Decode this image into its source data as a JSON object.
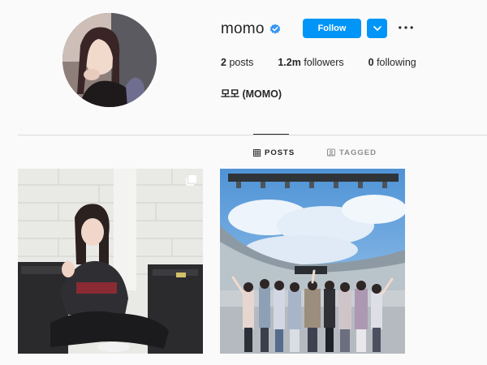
{
  "profile": {
    "username": "momo",
    "verified": true,
    "full_name": "모모 (MOMO)"
  },
  "actions": {
    "follow_label": "Follow",
    "dropdown_icon": "chevron-down-icon",
    "more_icon": "more-horizontal-icon"
  },
  "stats": {
    "posts_count": "2",
    "posts_label": "posts",
    "followers_count": "1.2m",
    "followers_label": "followers",
    "following_count": "0",
    "following_label": "following"
  },
  "tabs": [
    {
      "label": "POSTS",
      "icon": "grid-icon",
      "active": true
    },
    {
      "label": "TAGGED",
      "icon": "tagged-icon",
      "active": false
    }
  ],
  "colors": {
    "accent": "#0095f6",
    "text": "#262626",
    "muted": "#8e8e8e",
    "background": "#fafafa",
    "divider": "#dbdbdb"
  },
  "posts": [
    {
      "type": "multi-photo",
      "icon": "multiple-posts-icon"
    },
    {
      "type": "photo"
    }
  ]
}
